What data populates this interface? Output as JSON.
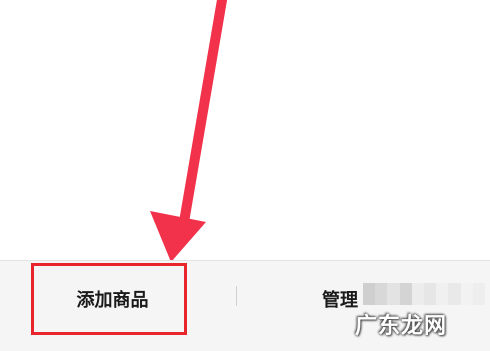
{
  "bottom_bar": {
    "add_button_label": "添加商品",
    "manage_button_label": "管理"
  },
  "watermark": {
    "text": "广东龙网"
  },
  "colors": {
    "annotation": "#f2314a",
    "highlight_border": "#e8242c",
    "bar_background": "#f5f5f5"
  }
}
